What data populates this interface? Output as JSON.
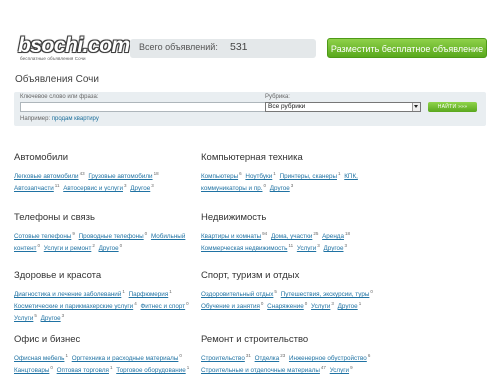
{
  "header": {
    "logo_text": "bsochi.com",
    "logo_tagline": "бесплатные объявления Сочи",
    "counter_label": "Всего объявлений:",
    "counter_value": "531",
    "post_button": "Разместить бесплатное объявление"
  },
  "page_title": "Объявления Сочи",
  "search": {
    "keyword_label": "Ключевое слово или фраза:",
    "keyword_value": "",
    "category_label": "Рубрика:",
    "category_selected": "Все рубрики",
    "find_button": "НАЙТИ »»»",
    "example_prefix": "Например:",
    "example_link": "продам квартиру"
  },
  "categories": [
    {
      "title": "Автомобили",
      "items": [
        {
          "label": "Легковые автомобили",
          "count": "43"
        },
        {
          "label": "Грузовые автомобили",
          "count": "18"
        },
        {
          "label": "Автозапчасти",
          "count": "11"
        },
        {
          "label": "Автосервис и услуги",
          "count": "3"
        },
        {
          "label": "Другое",
          "count": "3"
        }
      ]
    },
    {
      "title": "Компьютерная техника",
      "items": [
        {
          "label": "Компьютеры",
          "count": "6"
        },
        {
          "label": "Ноутбуки",
          "count": "1"
        },
        {
          "label": "Принтеры, сканеры",
          "count": "1"
        },
        {
          "label": "КПК, коммуникаторы и пр.",
          "count": "0"
        },
        {
          "label": "Другое",
          "count": "3"
        }
      ]
    },
    {
      "title": "Телефоны и связь",
      "items": [
        {
          "label": "Сотовые телефоны",
          "count": "9"
        },
        {
          "label": "Проводные телефоны",
          "count": "0"
        },
        {
          "label": "Мобильный контент",
          "count": "0"
        },
        {
          "label": "Услуги и ремонт",
          "count": "2"
        },
        {
          "label": "Другое",
          "count": "0"
        }
      ]
    },
    {
      "title": "Недвижимость",
      "items": [
        {
          "label": "Квартиры и комнаты",
          "count": "94"
        },
        {
          "label": "Дома, участки",
          "count": "25"
        },
        {
          "label": "Аренда",
          "count": "18"
        },
        {
          "label": "Коммерческая недвижимость",
          "count": "11"
        },
        {
          "label": "Услуги",
          "count": "3"
        },
        {
          "label": "Другое",
          "count": "3"
        }
      ]
    },
    {
      "title": "Здоровье и красота",
      "items": [
        {
          "label": "Диагностика и лечение заболеваний",
          "count": "1"
        },
        {
          "label": "Парфюмерия",
          "count": "1"
        },
        {
          "label": "Косметические и парикмахерские услуги",
          "count": "4"
        },
        {
          "label": "Фитнес и спорт",
          "count": "0"
        },
        {
          "label": "Услуги",
          "count": "5"
        },
        {
          "label": "Другое",
          "count": "3"
        }
      ]
    },
    {
      "title": "Спорт, туризм и отдых",
      "items": [
        {
          "label": "Оздоровительный отдых",
          "count": "5"
        },
        {
          "label": "Путешествия, экскурсии, туры",
          "count": "0"
        },
        {
          "label": "Обучение и занятия",
          "count": "0"
        },
        {
          "label": "Снаряжение",
          "count": "0"
        },
        {
          "label": "Услуги",
          "count": "3"
        },
        {
          "label": "Другое",
          "count": "1"
        }
      ]
    },
    {
      "title": "Офис и бизнес",
      "items": [
        {
          "label": "Офисная мебель",
          "count": "1"
        },
        {
          "label": "Оргтехника и расходные материалы",
          "count": "0"
        },
        {
          "label": "Канцтовары",
          "count": "0"
        },
        {
          "label": "Оптовая торговля",
          "count": "1"
        },
        {
          "label": "Торговое оборудование",
          "count": "1"
        },
        {
          "label": "Готовый бизнес",
          "count": "2"
        },
        {
          "label": "Услуги",
          "count": "3"
        },
        {
          "label": "Другое",
          "count": "1"
        }
      ]
    },
    {
      "title": "Ремонт и строительство",
      "items": [
        {
          "label": "Строительство",
          "count": "31"
        },
        {
          "label": "Отделка",
          "count": "23"
        },
        {
          "label": "Инженерное обустройство",
          "count": "6"
        },
        {
          "label": "Строительные и отделочные материалы",
          "count": "47"
        },
        {
          "label": "Услуги",
          "count": "9"
        },
        {
          "label": "Техника и инструменты",
          "count": "2"
        },
        {
          "label": "Другое",
          "count": "2"
        }
      ]
    }
  ]
}
